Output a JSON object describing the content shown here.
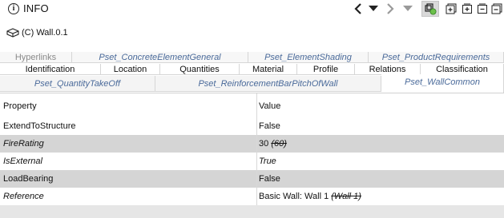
{
  "panel": {
    "title": "INFO"
  },
  "object": {
    "label": "(C) Wall.0.1"
  },
  "tabs": {
    "row1": [
      "Hyperlinks",
      "Pset_ConcreteElementGeneral",
      "Pset_ElementShading",
      "Pset_ProductRequirements"
    ],
    "row2": [
      "Identification",
      "Location",
      "Quantities",
      "Material",
      "Profile",
      "Relations",
      "Classification"
    ],
    "row3": [
      "Pset_QuantityTakeOff",
      "Pset_ReinforcementBarPitchOfWall",
      "Pset_WallCommon"
    ],
    "active": "Pset_WallCommon"
  },
  "table": {
    "headers": {
      "property": "Property",
      "value": "Value"
    },
    "rows": [
      {
        "property": "ExtendToStructure",
        "value": "False",
        "old_value": ""
      },
      {
        "property": "FireRating",
        "value": "30",
        "old_value": "(60)"
      },
      {
        "property": "IsExternal",
        "value": "True",
        "old_value": ""
      },
      {
        "property": "LoadBearing",
        "value": "False",
        "old_value": ""
      },
      {
        "property": "Reference",
        "value": "Basic Wall: Wall 1",
        "old_value": "(Wall 1)"
      }
    ]
  },
  "colors": {
    "pset_tab_text": "#4a6a9a",
    "row_grey": "#d5d5d5",
    "grid_bg": "#e6e6e6"
  },
  "toolbar_icons": [
    "chevron-left-icon",
    "caret-down-icon",
    "chevron-right-icon",
    "caret-down-icon",
    "object-filter-icon",
    "expand-all-icon",
    "expand-icon",
    "collapse-icon",
    "collapse-all-icon"
  ]
}
